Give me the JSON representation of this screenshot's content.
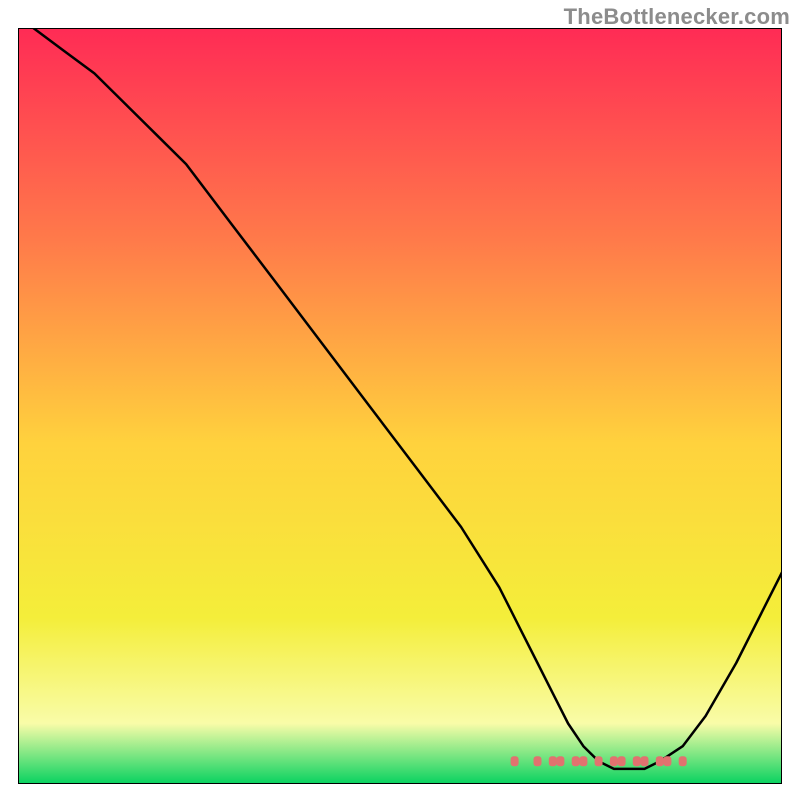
{
  "attribution": "TheBottlenecker.com",
  "colors": {
    "gradient_top": "#ff2b55",
    "gradient_mid_upper": "#ff7a4a",
    "gradient_mid": "#ffd23d",
    "gradient_mid_lower": "#f4ee3a",
    "gradient_band": "#f9fca8",
    "gradient_bottom": "#08d260",
    "curve": "#000000",
    "dot": "#e1726f",
    "frame": "#000000"
  },
  "chart_data": {
    "type": "line",
    "title": "",
    "xlabel": "",
    "ylabel": "",
    "xlim": [
      0,
      100
    ],
    "ylim": [
      0,
      100
    ],
    "grid": false,
    "legend": false,
    "series": [
      {
        "name": "curve",
        "x": [
          2,
          6,
          10,
          14,
          18,
          22,
          28,
          34,
          40,
          46,
          52,
          58,
          63,
          66,
          68,
          70,
          72,
          74,
          76,
          78,
          80,
          82,
          84,
          87,
          90,
          94,
          98,
          100
        ],
        "y": [
          100,
          97,
          94,
          90,
          86,
          82,
          74,
          66,
          58,
          50,
          42,
          34,
          26,
          20,
          16,
          12,
          8,
          5,
          3,
          2,
          2,
          2,
          3,
          5,
          9,
          16,
          24,
          28
        ]
      }
    ],
    "dots": {
      "name": "bottom-dots",
      "x": [
        65,
        68,
        70,
        71,
        73,
        74,
        76,
        78,
        79,
        81,
        82,
        84,
        85,
        87
      ],
      "y": [
        3,
        3,
        3,
        3,
        3,
        3,
        3,
        3,
        3,
        3,
        3,
        3,
        3,
        3
      ]
    }
  }
}
